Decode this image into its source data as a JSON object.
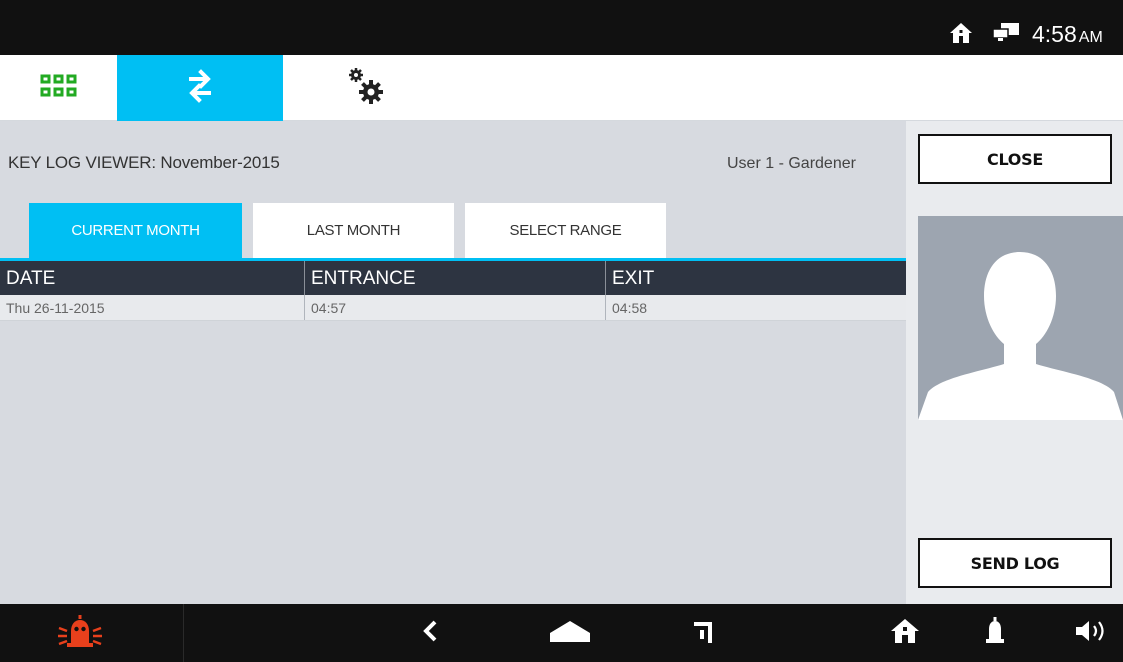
{
  "status_bar": {
    "icons": [
      "home-icon",
      "network-icon"
    ],
    "time": "4:58",
    "ampm": "AM"
  },
  "nav_tabs": [
    {
      "icon": "apps-grid-icon",
      "active": false
    },
    {
      "icon": "transfer-arrows-icon",
      "active": true
    },
    {
      "icon": "settings-gears-icon",
      "active": false
    }
  ],
  "main": {
    "title": "KEY LOG VIEWER:  November-2015",
    "user": "User 1 - Gardener",
    "tabs": [
      {
        "label": "CURRENT MONTH",
        "active": true
      },
      {
        "label": "LAST MONTH",
        "active": false
      },
      {
        "label": "SELECT RANGE",
        "active": false
      }
    ],
    "table": {
      "columns": [
        "DATE",
        "ENTRANCE",
        "EXIT"
      ],
      "rows": [
        [
          "Thu 26-11-2015",
          "04:57",
          "04:58"
        ]
      ]
    }
  },
  "side": {
    "close_label": "CLOSE",
    "send_log_label": "SEND LOG",
    "avatar_icon": "user-silhouette-icon"
  },
  "bottom_bar": {
    "icons": [
      "alarm-icon",
      "back-icon",
      "home-icon",
      "bypass-icon",
      "home-status-icon",
      "bell-icon",
      "speaker-icon"
    ]
  },
  "colors": {
    "accent": "#00bff3",
    "header_dark": "#2d3441",
    "alarm_red": "#e8401c",
    "apps_green": "#22aa22"
  }
}
